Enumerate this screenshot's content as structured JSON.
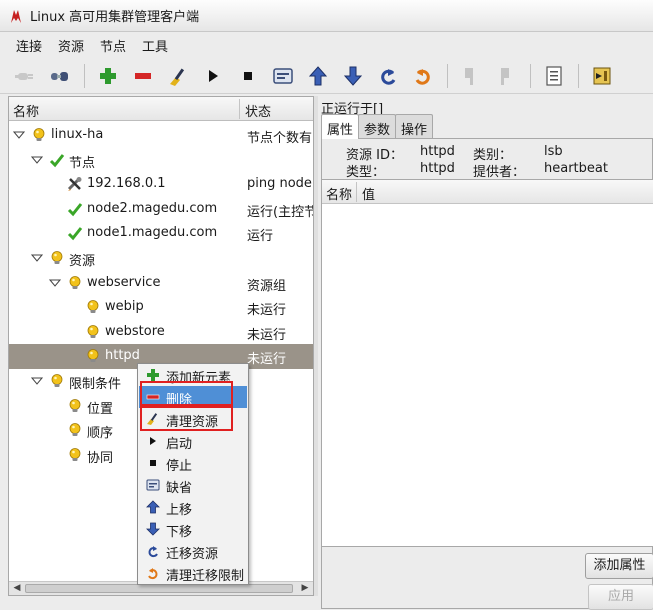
{
  "window": {
    "title": "Linux 高可用集群管理客户端"
  },
  "menu": [
    "连接",
    "资源",
    "节点",
    "工具"
  ],
  "toolbar": {
    "buttons": [
      {
        "name": "connect-button",
        "icon": "plug-icon",
        "enabled": false
      },
      {
        "name": "disconnect-button",
        "icon": "unplug-icon",
        "enabled": true
      },
      {
        "name": "add-button",
        "icon": "plus-icon",
        "enabled": true
      },
      {
        "name": "delete-button",
        "icon": "minus-icon",
        "enabled": true
      },
      {
        "name": "cleanup-button",
        "icon": "broom-icon",
        "enabled": true
      },
      {
        "name": "start-button",
        "icon": "play-icon",
        "enabled": true
      },
      {
        "name": "stop-button",
        "icon": "stop-icon",
        "enabled": true
      },
      {
        "name": "default-button",
        "icon": "default-icon",
        "enabled": true
      },
      {
        "name": "move-up-button",
        "icon": "arrow-up-icon",
        "enabled": true
      },
      {
        "name": "move-down-button",
        "icon": "arrow-down-icon",
        "enabled": true
      },
      {
        "name": "migrate-button",
        "icon": "migrate-icon",
        "enabled": true
      },
      {
        "name": "unmigrate-button",
        "icon": "unmigrate-icon",
        "enabled": true
      },
      {
        "name": "standby-button",
        "icon": "standby-icon",
        "enabled": false
      },
      {
        "name": "active-button",
        "icon": "active-icon",
        "enabled": false
      },
      {
        "name": "log-button",
        "icon": "document-icon",
        "enabled": true
      },
      {
        "name": "exit-button",
        "icon": "exit-icon",
        "enabled": true
      }
    ]
  },
  "tree": {
    "header": {
      "name": "名称",
      "status": "状态"
    },
    "rows": [
      {
        "label": "linux-ha",
        "status": "节点个数有",
        "icon": "bulb-icon",
        "level": 0,
        "expanded": true
      },
      {
        "label": "节点",
        "status": "",
        "icon": "check-icon",
        "level": 1,
        "expanded": true
      },
      {
        "label": "192.168.0.1",
        "status": "ping node",
        "icon": "tools-icon",
        "level": 2
      },
      {
        "label": "node2.magedu.com",
        "status": "运行(主控节",
        "icon": "check-icon",
        "level": 2
      },
      {
        "label": "node1.magedu.com",
        "status": "运行",
        "icon": "check-icon",
        "level": 2
      },
      {
        "label": "资源",
        "status": "",
        "icon": "bulb-icon",
        "level": 1,
        "expanded": true
      },
      {
        "label": "webservice",
        "status": "资源组",
        "icon": "bulb-icon",
        "level": 2,
        "expanded": true
      },
      {
        "label": "webip",
        "status": "未运行",
        "icon": "bulb-icon",
        "level": 3
      },
      {
        "label": "webstore",
        "status": "未运行",
        "icon": "bulb-icon",
        "level": 3
      },
      {
        "label": "httpd",
        "status": "未运行",
        "icon": "bulb-icon",
        "level": 3,
        "selected": true
      },
      {
        "label": "限制条件",
        "status": "",
        "icon": "bulb-icon",
        "level": 1,
        "expanded": true
      },
      {
        "label": "位置",
        "status": "",
        "icon": "bulb-icon",
        "level": 2
      },
      {
        "label": "顺序",
        "status": "",
        "icon": "bulb-icon",
        "level": 2
      },
      {
        "label": "协同",
        "status": "",
        "icon": "bulb-icon",
        "level": 2
      }
    ]
  },
  "context_menu": {
    "items": [
      {
        "label": "添加新元素",
        "icon": "plus-icon"
      },
      {
        "label": "删除",
        "icon": "minus-icon",
        "highlighted": true
      },
      {
        "label": "清理资源",
        "icon": "broom-icon"
      },
      {
        "label": "启动",
        "icon": "play-icon"
      },
      {
        "label": "停止",
        "icon": "stop-icon"
      },
      {
        "label": "缺省",
        "icon": "default-icon"
      },
      {
        "label": "上移",
        "icon": "arrow-up-icon"
      },
      {
        "label": "下移",
        "icon": "arrow-down-icon"
      },
      {
        "label": "迁移资源",
        "icon": "migrate-icon"
      },
      {
        "label": "清理迁移限制",
        "icon": "unmigrate-icon"
      }
    ]
  },
  "right_panel": {
    "title": "正运行于[]",
    "tabs": [
      "属性",
      "参数",
      "操作"
    ],
    "active_tab": "属性",
    "info": {
      "resource_id_label": "资源 ID：",
      "resource_id": "httpd",
      "class_label": "类别：",
      "class": "lsb",
      "type_label": "类型：",
      "type": "httpd",
      "provider_label": "提供者：",
      "provider": "heartbeat"
    },
    "table_header": {
      "name": "名称",
      "value": "值"
    },
    "buttons": {
      "add_attr": "添加属性",
      "apply": "应用"
    }
  },
  "colors": {
    "selected_row": "#9a9389",
    "menu_highlight": "#4f8fd6",
    "annotation_box": "#e02020",
    "bulb": "#f2c21b",
    "check": "#3aa628"
  }
}
